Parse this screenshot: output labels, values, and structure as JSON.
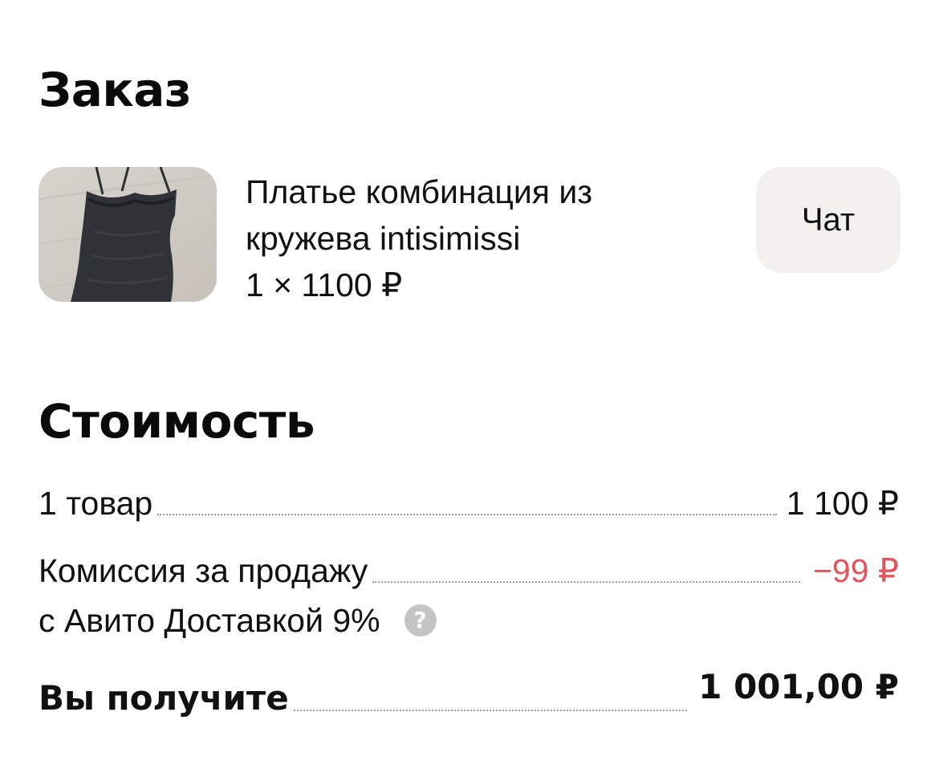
{
  "order": {
    "title": "Заказ",
    "item": {
      "title_line1": "Платье комбинация из",
      "title_line2": "кружева intisimissi",
      "quantity_price": "1 × 1100 ₽",
      "image_icon": "dress-photo"
    },
    "chat_label": "Чат"
  },
  "cost": {
    "title": "Стоимость",
    "items_label": "1 товар",
    "items_value": "1 100 ₽",
    "commission_label_line1": "Комиссия за продажу",
    "commission_label_line2": "с Авито Доставкой 9%",
    "commission_value": "−99 ₽",
    "help_icon": "?",
    "total_label": "Вы получите",
    "total_value": "1 001,00 ₽"
  },
  "colors": {
    "negative": "#e0555b",
    "chat_bg": "#f2f1f0",
    "help_icon_bg": "#c4c4c4"
  }
}
